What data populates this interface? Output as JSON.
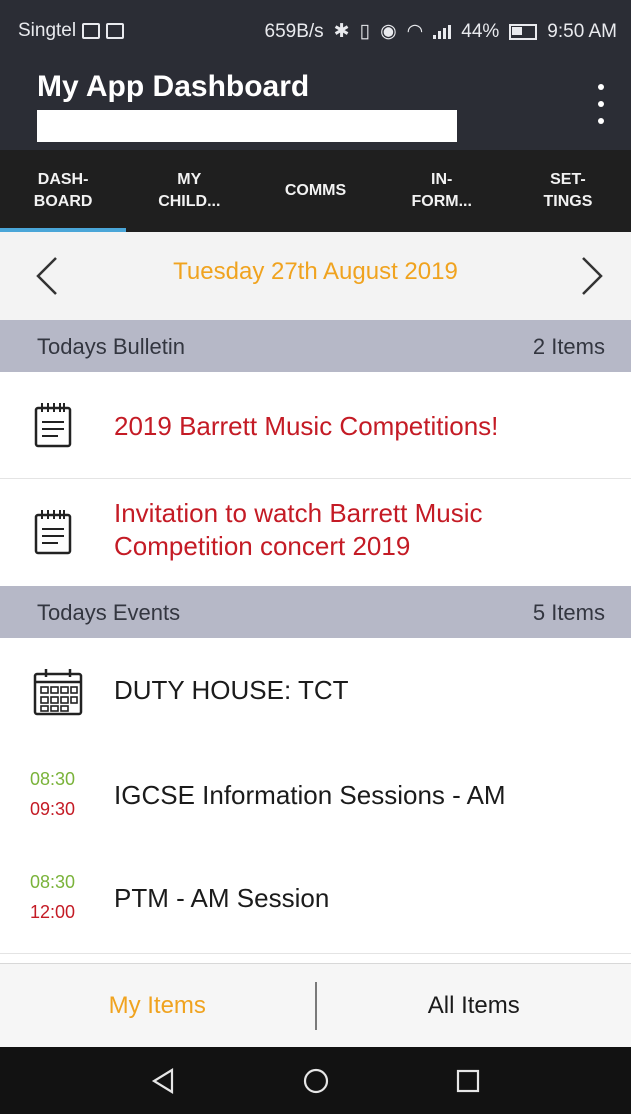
{
  "status_bar": {
    "carrier": "Singtel",
    "speed": "659B/s",
    "battery": "44%",
    "time": "9:50 AM"
  },
  "app": {
    "title": "My App Dashboard",
    "subtitle": ""
  },
  "tabs": [
    {
      "label": "DASH-\nBOARD",
      "active": true
    },
    {
      "label": "MY\nCHILD...",
      "active": false
    },
    {
      "label": "COMMS",
      "active": false
    },
    {
      "label": "IN-\nFORM...",
      "active": false
    },
    {
      "label": "SET-\nTINGS",
      "active": false
    }
  ],
  "date_nav": {
    "date": "Tuesday 27th August 2019"
  },
  "bulletin": {
    "title": "Todays Bulletin",
    "count": "2 Items",
    "items": [
      {
        "icon": "notepad-icon",
        "text": "2019 Barrett Music Competitions!"
      },
      {
        "icon": "notepad-icon",
        "text": "Invitation to watch Barrett Music Competition concert 2019"
      }
    ]
  },
  "events": {
    "title": "Todays Events",
    "count": "5 Items",
    "items": [
      {
        "icon": "calendar-icon",
        "text": "DUTY HOUSE: TCT",
        "start": "",
        "end": ""
      },
      {
        "icon": "",
        "text": "IGCSE Information Sessions - AM",
        "start": "08:30",
        "end": "09:30"
      },
      {
        "icon": "",
        "text": "PTM - AM Session",
        "start": "08:30",
        "end": "12:00"
      }
    ]
  },
  "bottom_tabs": {
    "my_items": "My Items",
    "all_items": "All Items"
  },
  "colors": {
    "header": "#2b2d35",
    "tabbar": "#1f1f1f",
    "accent": "#f0a31f",
    "bulletin_red": "#c41b25",
    "start_green": "#7ab33a",
    "section": "#b6b8c7"
  }
}
